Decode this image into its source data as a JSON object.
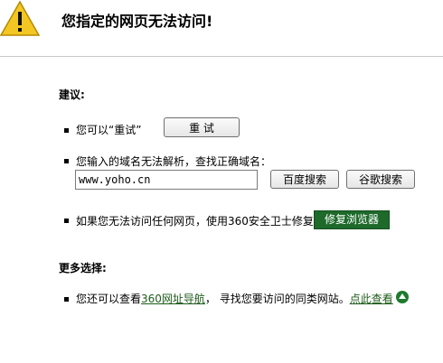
{
  "header": {
    "title": "您指定的网页无法访问!"
  },
  "suggestions": {
    "heading": "建议:",
    "retry_text": "您可以“重试”",
    "retry_button": "重 试",
    "domain_text": "您输入的域名无法解析，查找正确域名：",
    "domain_value": "www.yoho.cn",
    "baidu_button": "百度搜索",
    "google_button": "谷歌搜索",
    "repair_text": "如果您无法访问任何网页，使用360安全卫士修复",
    "repair_button": "修复浏览器"
  },
  "more": {
    "heading": "更多选择:",
    "text_before": "您还可以查看",
    "nav_link": "360网址导航",
    "text_middle": "，  寻找您要访问的同类网站。",
    "view_link": "点此查看"
  },
  "icons": {
    "warning": "warning-icon",
    "up_arrow": "arrow-up-circle-icon"
  },
  "colors": {
    "warning_fill": "#f3c623",
    "repair_button_bg": "#1d6a2b",
    "link": "#1d5b1a"
  }
}
